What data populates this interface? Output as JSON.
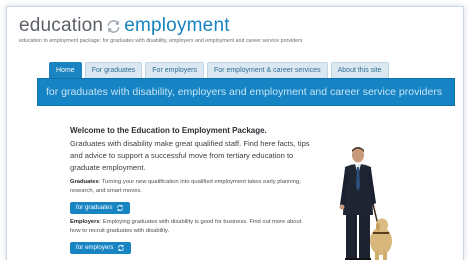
{
  "header": {
    "logo_word1": "education",
    "logo_word2": "employment",
    "tagline": "education to employment package: for graduates with disability, employers and employment and career service providers"
  },
  "nav": {
    "tabs": [
      {
        "label": "Home",
        "active": true
      },
      {
        "label": "For graduates",
        "active": false
      },
      {
        "label": "For employers",
        "active": false
      },
      {
        "label": "For employment & career services",
        "active": false
      },
      {
        "label": "About this site",
        "active": false
      }
    ]
  },
  "banner": {
    "text": "for graduates with disability, employers and employment and career service providers"
  },
  "main": {
    "welcome_title": "Welcome to the Education to Employment Package.",
    "welcome_body": "Graduates with disability make great qualified staff. Find here facts, tips and advice to support a successful move from tertiary education to graduate employment.",
    "graduates_label": "Graduates",
    "graduates_text": ": Turning your new qualification into qualified employment takes early planning, research, and smart moves.",
    "graduates_button": "for graduates",
    "employers_label": "Employers",
    "employers_text": ": Employing graduates with disability is good for business. Find out more about how to recruit graduates with disability.",
    "employers_button": "for employers"
  },
  "colors": {
    "brand_blue": "#1784c4",
    "logo_gray": "#5c6168",
    "banner_text": "#c6e3f4",
    "tab_inactive_bg": "#dbe8f1"
  },
  "icons": {
    "logo": "cycle-arrows-icon",
    "button": "refresh-arrows-icon"
  }
}
